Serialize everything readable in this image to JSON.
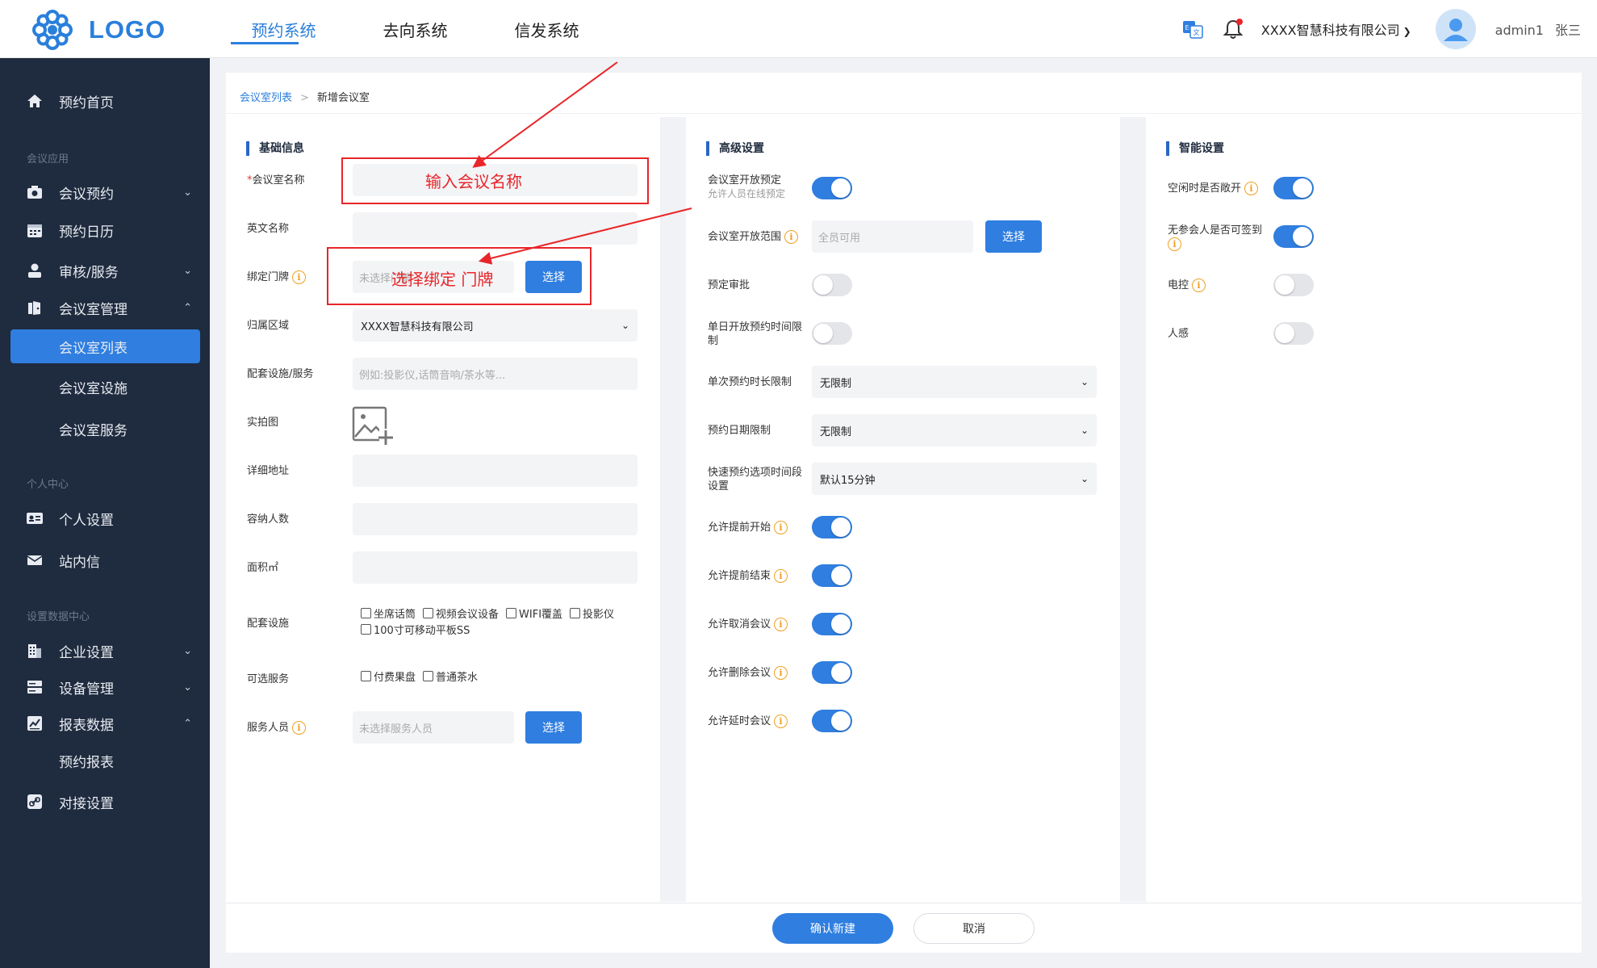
{
  "header": {
    "logo_text": "LOGO",
    "nav": [
      {
        "label": "预约系统",
        "active": true
      },
      {
        "label": "去向系统",
        "active": false
      },
      {
        "label": "信发系统",
        "active": false
      }
    ],
    "company": "XXXX智慧科技有限公司",
    "username": "admin1",
    "display_name": "张三"
  },
  "sidebar": {
    "home": "预约首页",
    "group_meeting": "会议应用",
    "meeting_reserve": "会议预约",
    "reserve_calendar": "预约日历",
    "audit_service": "审核/服务",
    "room_manage": "会议室管理",
    "room_list": "会议室列表",
    "room_facility": "会议室设施",
    "room_service": "会议室服务",
    "group_personal": "个人中心",
    "personal_settings": "个人设置",
    "inbox": "站内信",
    "group_settings": "设置数据中心",
    "enterprise_settings": "企业设置",
    "device_manage": "设备管理",
    "report_data": "报表数据",
    "reserve_report": "预约报表",
    "integration": "对接设置"
  },
  "breadcrumb": {
    "parent": "会议室列表",
    "current": "新增会议室"
  },
  "basic": {
    "title": "基础信息",
    "name_label": "会议室名称",
    "name_required_mark": "*",
    "en_name_label": "英文名称",
    "doorplate_label": "绑定门牌",
    "doorplate_placeholder": "未选择门牌",
    "select_btn": "选择",
    "area_label": "归属区域",
    "area_value": "XXXX智慧科技有限公司",
    "facility_service_label": "配套设施/服务",
    "facility_service_placeholder": "例如:投影仪,话筒音响/茶水等...",
    "photo_label": "实拍图",
    "address_label": "详细地址",
    "capacity_label": "容纳人数",
    "area_size_label": "面积㎡",
    "facilities_label": "配套设施",
    "facilities": [
      "坐席话筒",
      "视频会议设备",
      "WIFI覆盖",
      "投影仪",
      "100寸可移动平板SS"
    ],
    "services_label": "可选服务",
    "services": [
      "付费果盘",
      "普通茶水"
    ],
    "staff_label": "服务人员",
    "staff_placeholder": "未选择服务人员"
  },
  "advanced": {
    "title": "高级设置",
    "open_reserve_label": "会议室开放预定",
    "open_reserve_sub": "允许人员在线预定",
    "open_reserve_on": true,
    "open_scope_label": "会议室开放范围",
    "open_scope_placeholder": "全员可用",
    "select_btn": "选择",
    "approval_label": "预定审批",
    "approval_on": false,
    "daily_time_label": "单日开放预约时间限制",
    "daily_time_on": false,
    "single_duration_label": "单次预约时长限制",
    "single_duration_value": "无限制",
    "date_limit_label": "预约日期限制",
    "date_limit_value": "无限制",
    "quick_interval_label": "快速预约选项时间段设置",
    "quick_interval_value": "默认15分钟",
    "early_start_label": "允许提前开始",
    "early_start_on": true,
    "early_end_label": "允许提前结束",
    "early_end_on": true,
    "cancel_label": "允许取消会议",
    "cancel_on": true,
    "delete_label": "允许删除会议",
    "delete_on": true,
    "extend_label": "允许延时会议",
    "extend_on": true
  },
  "smart": {
    "title": "智能设置",
    "idle_open_label": "空闲时是否敞开",
    "idle_open_on": true,
    "no_attendee_signin_label": "无参会人是否可签到",
    "no_attendee_signin_on": true,
    "power_control_label": "电控",
    "power_control_on": false,
    "sensor_label": "人感",
    "sensor_on": false
  },
  "footer": {
    "confirm": "确认新建",
    "cancel": "取消"
  },
  "annotations": {
    "name_hint": "输入会议名称",
    "doorplate_hint": "选择绑定 门牌"
  },
  "colors": {
    "primary": "#2f7ee0",
    "sidebar_bg": "#1f2b3e",
    "annotation": "#e8262a",
    "info": "#f0a020"
  }
}
